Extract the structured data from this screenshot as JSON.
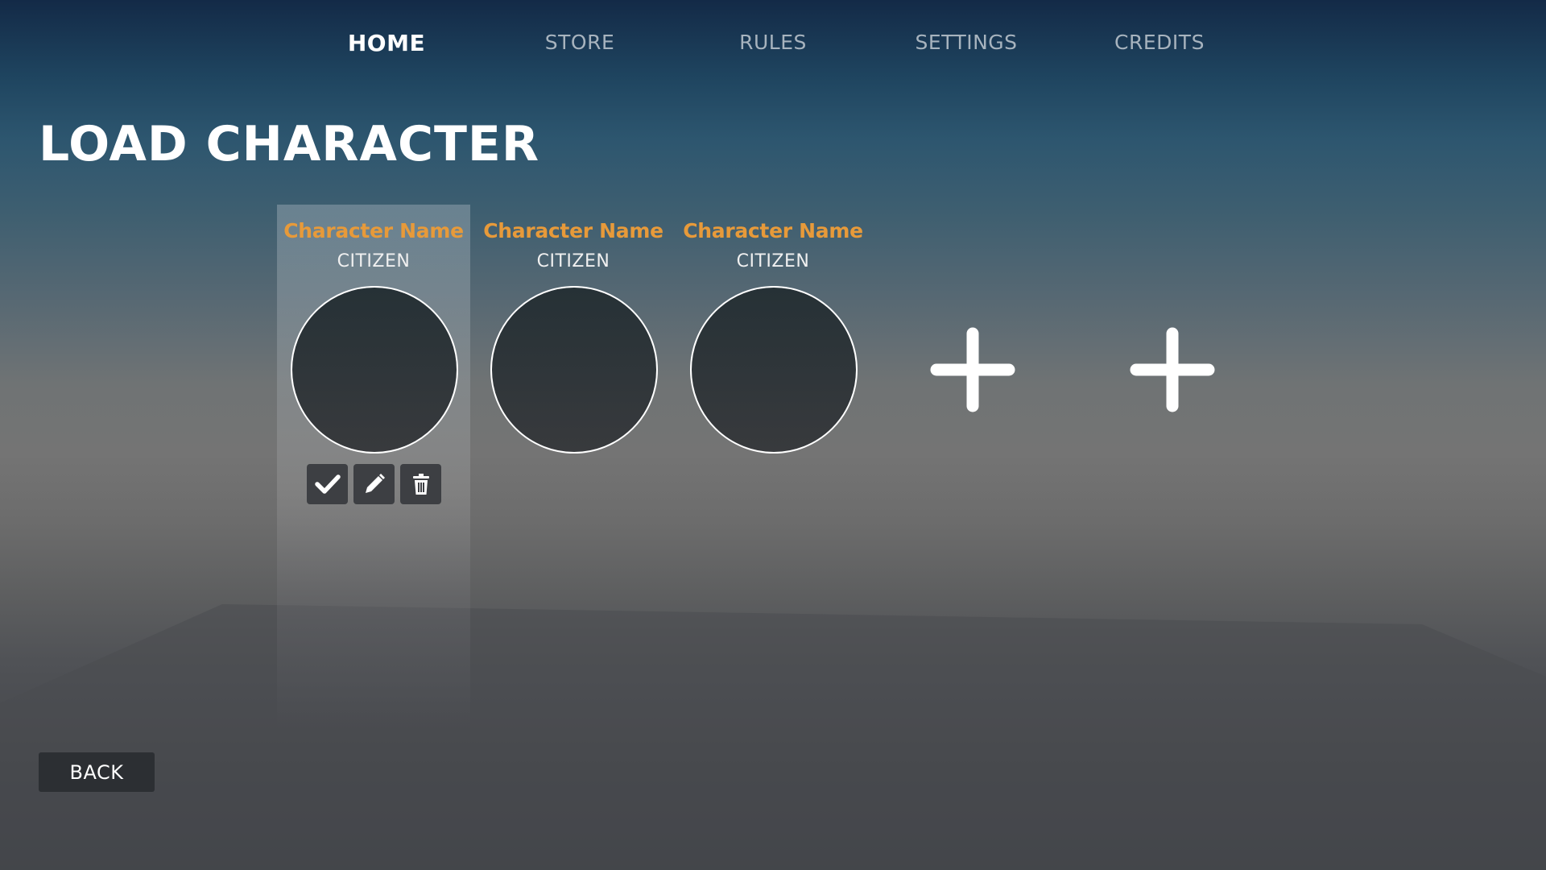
{
  "nav": {
    "items": [
      {
        "label": "HOME",
        "active": true
      },
      {
        "label": "STORE",
        "active": false
      },
      {
        "label": "RULES",
        "active": false
      },
      {
        "label": "SETTINGS",
        "active": false
      },
      {
        "label": "CREDITS",
        "active": false
      }
    ]
  },
  "page": {
    "title": "LOAD CHARACTER"
  },
  "characters": [
    {
      "name": "Character Name",
      "class": "CITIZEN",
      "selected": true
    },
    {
      "name": "Character Name",
      "class": "CITIZEN",
      "selected": false
    },
    {
      "name": "Character Name",
      "class": "CITIZEN",
      "selected": false
    }
  ],
  "character_actions": [
    {
      "icon": "checkmark-icon",
      "action": "select"
    },
    {
      "icon": "pencil-icon",
      "action": "edit"
    },
    {
      "icon": "trash-icon",
      "action": "delete"
    }
  ],
  "empty_slots": [
    {
      "icon": "plus-icon"
    },
    {
      "icon": "plus-icon"
    }
  ],
  "footer": {
    "back_label": "BACK"
  },
  "colors": {
    "accent_name": "#e79a3a",
    "nav_inactive": "#a7b3be",
    "button_bg": "#3d3f43"
  }
}
